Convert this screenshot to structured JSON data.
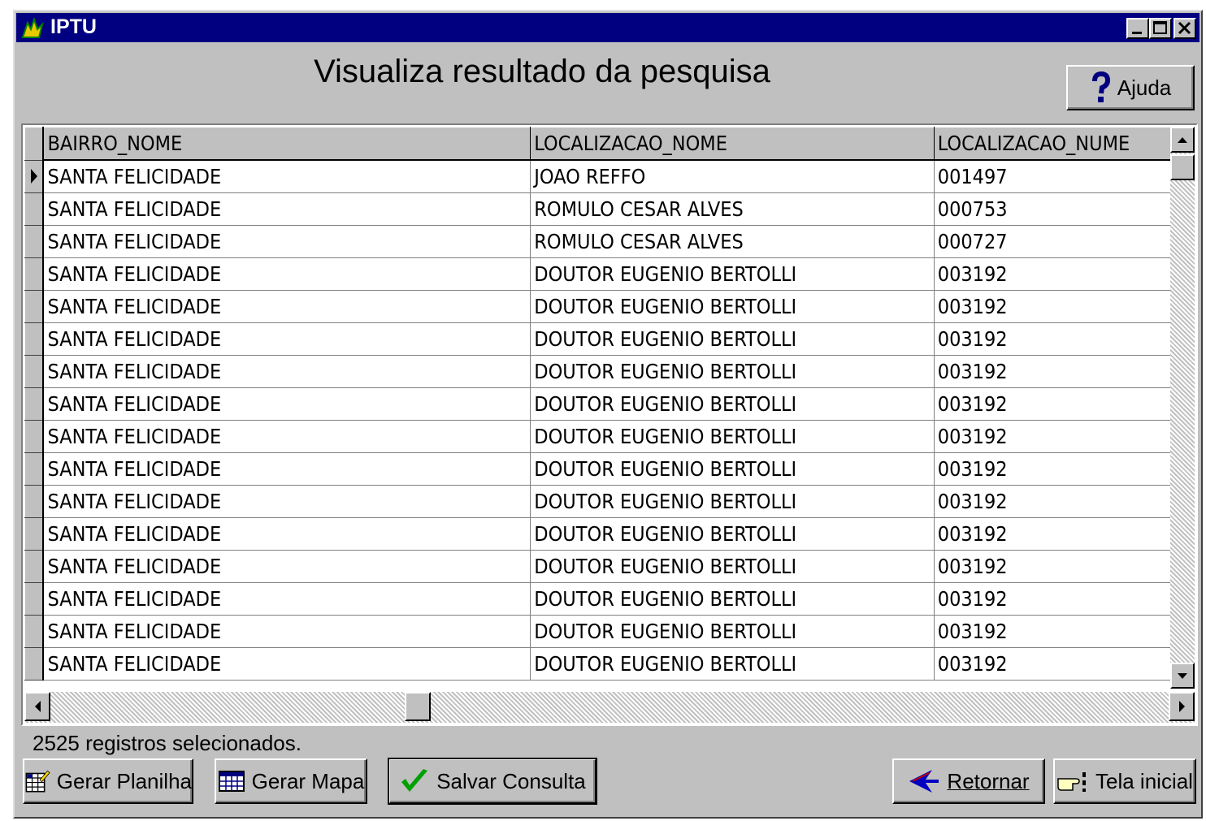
{
  "window": {
    "title": "IPTU"
  },
  "header": {
    "title": "Visualiza resultado da pesquisa",
    "help_label": "Ajuda"
  },
  "grid": {
    "columns": [
      "BAIRRO_NOME",
      "LOCALIZACAO_NOME",
      "LOCALIZACAO_NUME"
    ],
    "rows": [
      [
        "SANTA FELICIDADE",
        "JOAO REFFO",
        "001497"
      ],
      [
        "SANTA FELICIDADE",
        "ROMULO CESAR ALVES",
        "000753"
      ],
      [
        "SANTA FELICIDADE",
        "ROMULO CESAR ALVES",
        "000727"
      ],
      [
        "SANTA FELICIDADE",
        "DOUTOR EUGENIO BERTOLLI",
        "003192"
      ],
      [
        "SANTA FELICIDADE",
        "DOUTOR EUGENIO BERTOLLI",
        "003192"
      ],
      [
        "SANTA FELICIDADE",
        "DOUTOR EUGENIO BERTOLLI",
        "003192"
      ],
      [
        "SANTA FELICIDADE",
        "DOUTOR EUGENIO BERTOLLI",
        "003192"
      ],
      [
        "SANTA FELICIDADE",
        "DOUTOR EUGENIO BERTOLLI",
        "003192"
      ],
      [
        "SANTA FELICIDADE",
        "DOUTOR EUGENIO BERTOLLI",
        "003192"
      ],
      [
        "SANTA FELICIDADE",
        "DOUTOR EUGENIO BERTOLLI",
        "003192"
      ],
      [
        "SANTA FELICIDADE",
        "DOUTOR EUGENIO BERTOLLI",
        "003192"
      ],
      [
        "SANTA FELICIDADE",
        "DOUTOR EUGENIO BERTOLLI",
        "003192"
      ],
      [
        "SANTA FELICIDADE",
        "DOUTOR EUGENIO BERTOLLI",
        "003192"
      ],
      [
        "SANTA FELICIDADE",
        "DOUTOR EUGENIO BERTOLLI",
        "003192"
      ],
      [
        "SANTA FELICIDADE",
        "DOUTOR EUGENIO BERTOLLI",
        "003192"
      ],
      [
        "SANTA FELICIDADE",
        "DOUTOR EUGENIO BERTOLLI",
        "003192"
      ]
    ],
    "selected_row": 0
  },
  "status": {
    "text": "2525 registros selecionados."
  },
  "toolbar": {
    "gerar_planilha": "Gerar Planilha",
    "gerar_mapa": "Gerar Mapa",
    "salvar_consulta": "Salvar Consulta",
    "retornar": "Retornar",
    "tela_inicial": "Tela inicial"
  },
  "icons": {
    "app": "iptu-app-icon",
    "help": "question-mark-icon",
    "spreadsheet": "spreadsheet-icon",
    "map": "grid-map-icon",
    "save": "green-check-icon",
    "back": "left-arrow-icon",
    "home": "pointing-hand-icon"
  },
  "colors": {
    "titlebar": "#000080",
    "face": "#c0c0c0",
    "check": "#00a000",
    "back_arrow": "#0000c0",
    "help": "#000080"
  }
}
